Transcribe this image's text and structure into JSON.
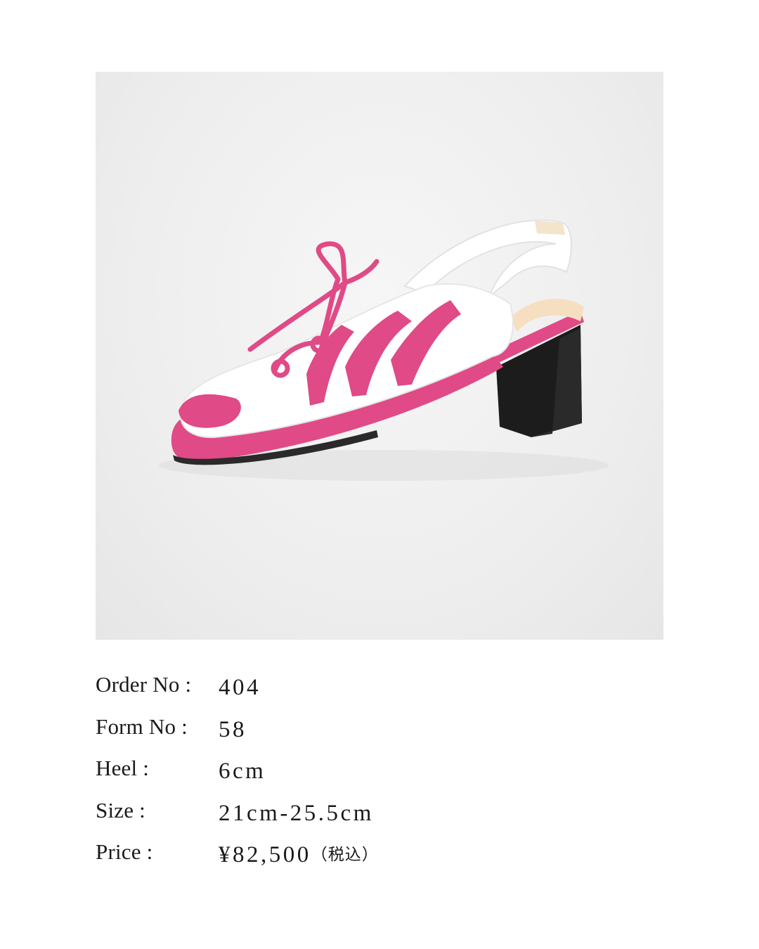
{
  "product": {
    "image": {
      "subject-icon": "sandal-illustration",
      "colors": {
        "upper": "#ffffff",
        "accent": "#e04a86",
        "heel": "#1c1c1c",
        "lining": "#f5dfc0"
      }
    },
    "specs": [
      {
        "label": "Order No :",
        "value": "404"
      },
      {
        "label": "Form No :",
        "value": "58"
      },
      {
        "label": "Heel :",
        "value": "6cm"
      },
      {
        "label": "Size :",
        "value": "21cm-25.5cm"
      },
      {
        "label": "Price :",
        "value": "¥82,500",
        "suffix": "（税込）"
      }
    ]
  }
}
